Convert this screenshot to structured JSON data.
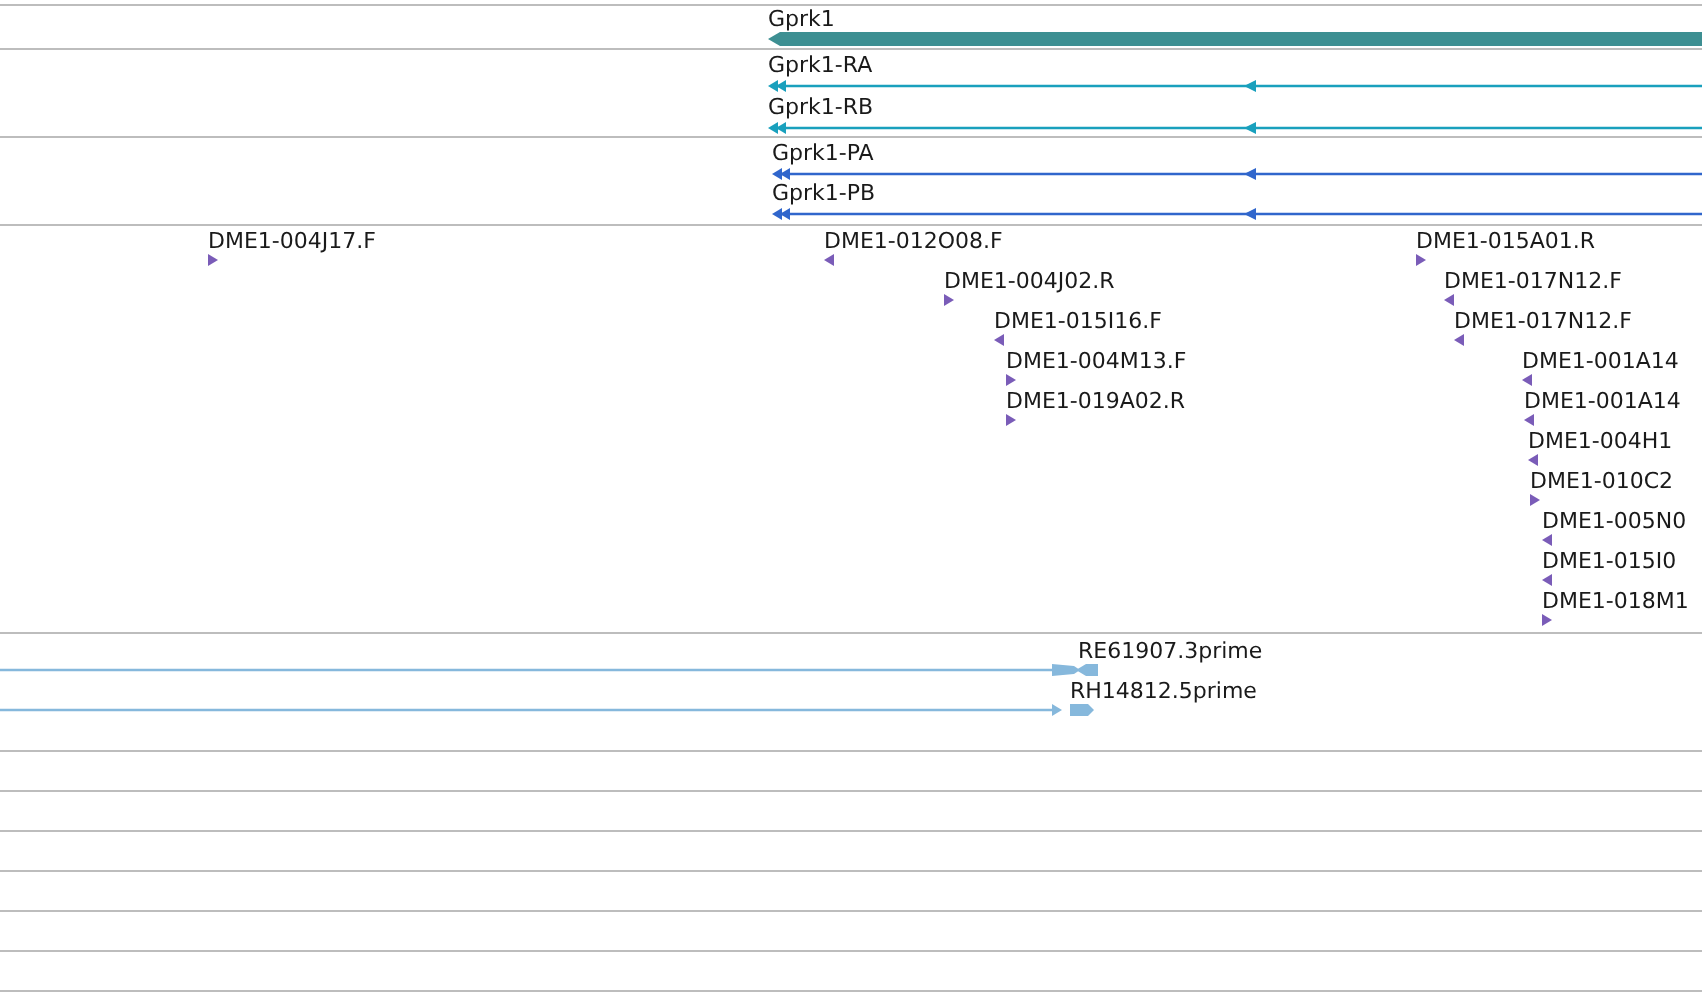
{
  "gene_track": {
    "gene": {
      "name": "Gprk1"
    }
  },
  "transcript_track": {
    "transcripts": [
      {
        "name": "Gprk1-RA"
      },
      {
        "name": "Gprk1-RB"
      }
    ]
  },
  "protein_track": {
    "proteins": [
      {
        "name": "Gprk1-PA"
      },
      {
        "name": "Gprk1-PB"
      }
    ]
  },
  "read_track": {
    "reads": [
      {
        "name": "DME1-004J17.F",
        "reverse": false
      },
      {
        "name": "DME1-012O08.F",
        "reverse": true
      },
      {
        "name": "DME1-004J02.R",
        "reverse": false
      },
      {
        "name": "DME1-015I16.F",
        "reverse": true
      },
      {
        "name": "DME1-004M13.F",
        "reverse": false
      },
      {
        "name": "DME1-019A02.R",
        "reverse": false
      },
      {
        "name": "DME1-015A01.R",
        "reverse": false
      },
      {
        "name": "DME1-017N12.F",
        "reverse": true
      },
      {
        "name": "DME1-017N12.F",
        "reverse": true
      },
      {
        "name": "DME1-001A14",
        "reverse": true
      },
      {
        "name": "DME1-001A14",
        "reverse": true
      },
      {
        "name": "DME1-004H1",
        "reverse": true
      },
      {
        "name": "DME1-010C2",
        "reverse": false
      },
      {
        "name": "DME1-005N0",
        "reverse": true
      },
      {
        "name": "DME1-015I0",
        "reverse": true
      },
      {
        "name": "DME1-018M1",
        "reverse": false
      }
    ]
  },
  "est_track": {
    "ests": [
      {
        "name": "RE61907.3prime"
      },
      {
        "name": "RH14812.5prime"
      }
    ]
  }
}
